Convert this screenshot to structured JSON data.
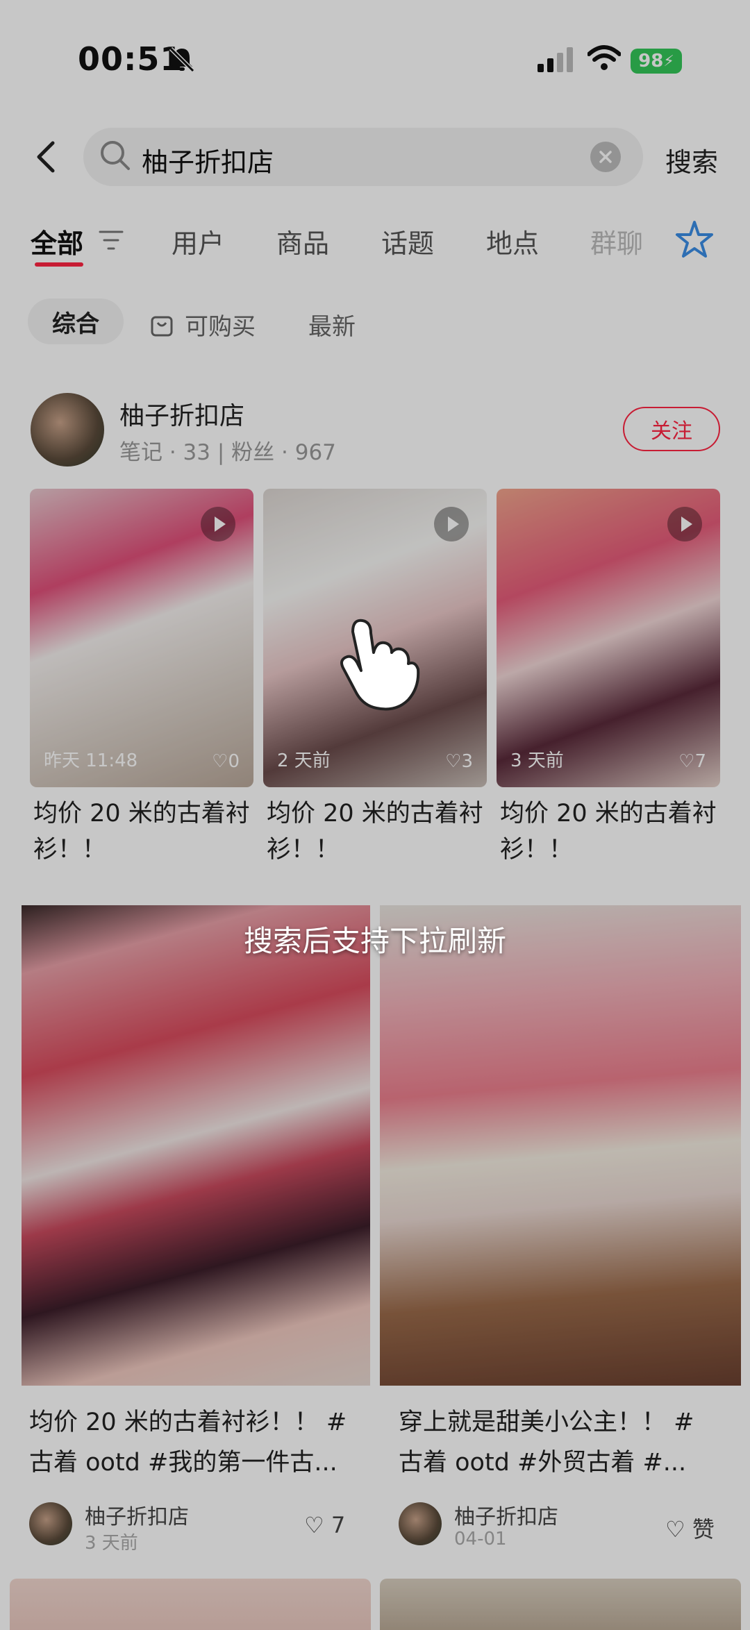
{
  "status_bar": {
    "time": "00:51",
    "battery": "98"
  },
  "search": {
    "query": "柚子折扣店",
    "button": "搜索"
  },
  "tabs": [
    {
      "label": "全部"
    },
    {
      "label": "用户"
    },
    {
      "label": "商品"
    },
    {
      "label": "话题"
    },
    {
      "label": "地点"
    },
    {
      "label": "群聊"
    }
  ],
  "filters": {
    "all": "综合",
    "buy": "可购买",
    "latest": "最新"
  },
  "user": {
    "name": "柚子折扣店",
    "meta": "笔记 · 33 | 粉丝 · 967",
    "follow": "关注"
  },
  "note_cards": [
    {
      "time": "昨天 11:48",
      "likes": "0",
      "title": "均价 20 米的古着衬衫！！"
    },
    {
      "time": "2 天前",
      "likes": "3",
      "title": "均价 20 米的古着衬衫！！"
    },
    {
      "time": "3 天前",
      "likes": "7",
      "title": "均价 20 米的古着衬衫！！"
    }
  ],
  "toast": "搜索后支持下拉刷新",
  "feed": [
    {
      "title": "均价 20 米的古着衬衫！！ # 古着 ootd #我的第一件古...",
      "author": "柚子折扣店",
      "date": "3 天前",
      "likes": "7"
    },
    {
      "title": "穿上就是甜美小公主！！ # 古着 ootd #外贸古着 #...",
      "author": "柚子折扣店",
      "date": "04-01",
      "likes": "赞"
    }
  ],
  "colors": {
    "accent": "#ff2442",
    "battery": "#34c759"
  },
  "icons": [
    "back-icon",
    "search-icon",
    "clear-icon",
    "filter-icon",
    "ai-star-icon",
    "shopping-bag-icon",
    "play-icon",
    "heart-icon",
    "bell-off-icon",
    "signal-icon",
    "wifi-icon",
    "hand-pointer-icon"
  ]
}
